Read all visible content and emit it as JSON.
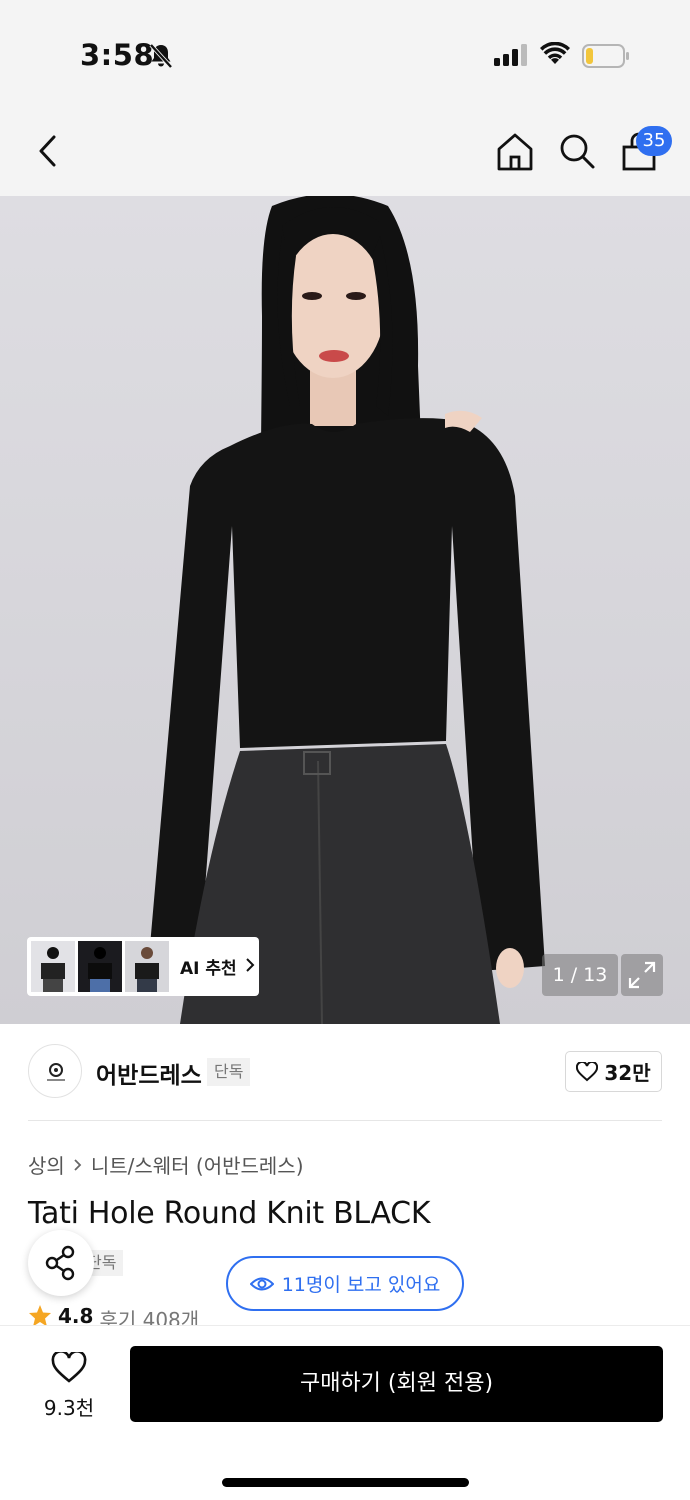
{
  "status_bar": {
    "time": "3:58"
  },
  "header": {
    "cart_count": "35"
  },
  "gallery": {
    "ai_recommend_label": "AI 추천",
    "counter": "1 / 13"
  },
  "brand": {
    "name": "어반드레스",
    "tag": "단독",
    "like_count": "32만"
  },
  "product": {
    "breadcrumb": [
      "상의",
      "니트/스웨터 (어반드레스)"
    ],
    "title": "Tati Hole Round Knit BLACK",
    "exclusive_tag": "단독",
    "viewers_text": "11명이 보고 있어요",
    "rating": "4.8",
    "reviews": "후기 408개"
  },
  "bottom_bar": {
    "wish_count": "9.3천",
    "buy_label": "구매하기 (회원 전용)"
  },
  "colors": {
    "accent": "#2f6ff0",
    "star": "#f5a623",
    "buy_bg": "#000000"
  }
}
